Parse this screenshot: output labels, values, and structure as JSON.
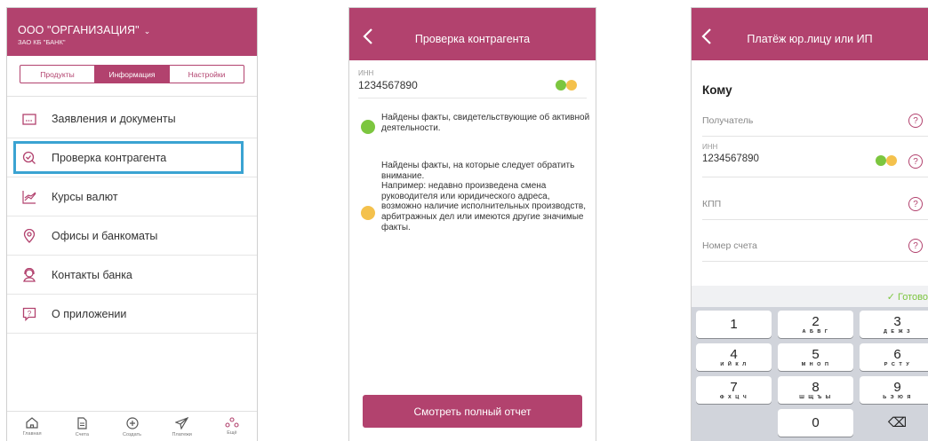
{
  "screen1": {
    "org": "ООО \"ОРГАНИЗАЦИЯ\"",
    "bank": "ЗАО КБ \"БАНК\"",
    "segments": [
      "Продукты",
      "Информация",
      "Настройки"
    ],
    "menu": [
      "Заявления и документы",
      "Проверка контрагента",
      "Курсы валют",
      "Офисы и банкоматы",
      "Контакты банка",
      "О приложении"
    ],
    "tabs": [
      "Главная",
      "Счета",
      "Создать",
      "Платежи",
      "Ещё"
    ]
  },
  "screen2": {
    "title": "Проверка контрагента",
    "inn_label": "ИНН",
    "inn_value": "1234567890",
    "fact1": "Найдены факты, свидетельствующие об активной деятельности.",
    "fact2": "Найдены факты, на которые следует обратить внимание.\nНапример: недавно произведена смена руководителя или юридического адреса, возможно наличие исполнительных производств, арбитражных дел или имеются другие значимые факты.",
    "button": "Смотреть полный отчет"
  },
  "screen3": {
    "title": "Платёж юр.лицу или ИП",
    "section": "Кому",
    "recipient": "Получатель",
    "inn_label": "ИНН",
    "inn_value": "1234567890",
    "kpp": "КПП",
    "account": "Номер счета",
    "done": "✓ Готово",
    "keys": [
      {
        "n": "1",
        "s": ""
      },
      {
        "n": "2",
        "s": "А Б В Г"
      },
      {
        "n": "3",
        "s": "Д Е Ж З"
      },
      {
        "n": "4",
        "s": "И Й К Л"
      },
      {
        "n": "5",
        "s": "М Н О П"
      },
      {
        "n": "6",
        "s": "Р С Т У"
      },
      {
        "n": "7",
        "s": "Ф Х Ц Ч"
      },
      {
        "n": "8",
        "s": "Ш Щ Ъ Ы"
      },
      {
        "n": "9",
        "s": "Ь Э Ю Я"
      },
      {
        "n": "",
        "s": ""
      },
      {
        "n": "0",
        "s": ""
      },
      {
        "n": "⌫",
        "s": ""
      }
    ]
  },
  "colors": {
    "accent": "#b2426e",
    "green": "#7cc63f",
    "yellow": "#f4c14c",
    "highlight": "#3aa3d2"
  }
}
